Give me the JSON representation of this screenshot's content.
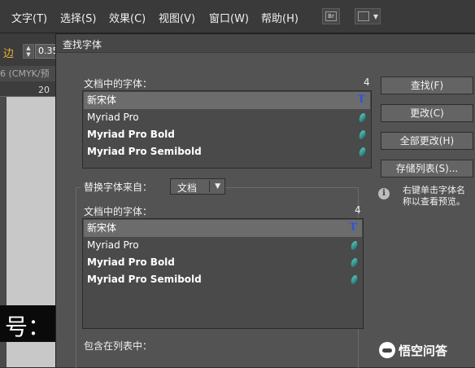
{
  "menubar": {
    "items": [
      "文字(T)",
      "选择(S)",
      "效果(C)",
      "视图(V)",
      "窗口(W)",
      "帮助(H)"
    ],
    "bridge_icon": "Br"
  },
  "background": {
    "edge_label": "边",
    "num_value": "0.35",
    "doc_tab": "6 (CMYK/预",
    "ruler_number": "20",
    "canvas_text": "号："
  },
  "dialog": {
    "title": "查找字体",
    "doc_fonts_label": "文档中的字体：",
    "doc_fonts_count": "4",
    "fonts": [
      {
        "name": "新宋体",
        "icon": "T",
        "bold": false
      },
      {
        "name": "Myriad Pro",
        "icon": "O",
        "bold": false
      },
      {
        "name": "Myriad Pro Bold",
        "icon": "O",
        "bold": true
      },
      {
        "name": "Myriad Pro Semibold",
        "icon": "O",
        "bold": true
      }
    ],
    "buttons": {
      "find": "查找(F)",
      "change": "更改(C)",
      "change_all": "全部更改(H)",
      "save_list": "存储列表(S)..."
    },
    "replace_label": "替换字体来自：",
    "replace_source": "文档",
    "replace_fonts_label": "文档中的字体：",
    "replace_fonts_count": "4",
    "replace_fonts": [
      {
        "name": "新宋体",
        "icon": "T",
        "bold": false
      },
      {
        "name": "Myriad Pro",
        "icon": "O",
        "bold": false
      },
      {
        "name": "Myriad Pro Bold",
        "icon": "O",
        "bold": true
      },
      {
        "name": "Myriad Pro Semibold",
        "icon": "O",
        "bold": true
      }
    ],
    "include_label": "包含在列表中：",
    "info_text": "右键单击字体名称以查看预览。"
  },
  "watermark": "悟空问答"
}
